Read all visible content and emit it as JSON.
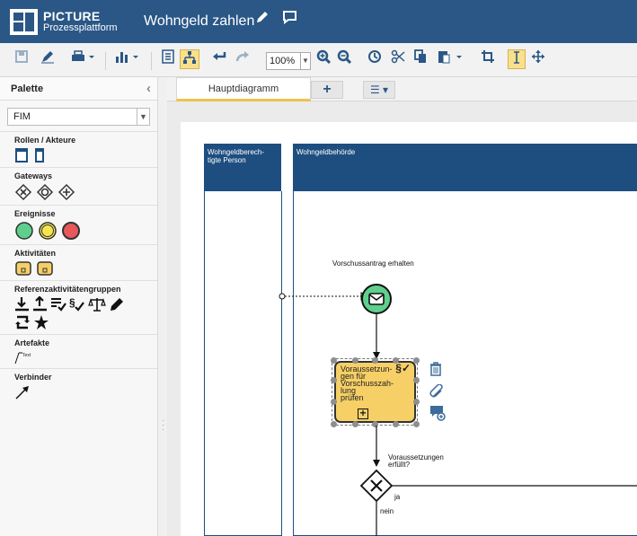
{
  "header": {
    "brand_line1": "PICTURE",
    "brand_line2": "Prozessplattform",
    "document_title": "Wohngeld zahlen",
    "edit_icon": "pencil-icon",
    "comment_icon": "speech-bubble-icon"
  },
  "toolbar": {
    "zoom_value": "100%",
    "icons": [
      "save-icon",
      "sign-icon",
      "print-icon",
      "chart-icon",
      "list-icon",
      "hierarchy-icon",
      "undo-icon",
      "redo-icon",
      "zoom-in-icon",
      "zoom-out-icon",
      "history-icon",
      "cut-icon",
      "copy-icon",
      "paste-icon",
      "crop-icon",
      "text-cursor-icon",
      "move-icon"
    ]
  },
  "palette": {
    "title": "Palette",
    "library": "FIM",
    "sections": [
      {
        "title": "Rollen / Akteure"
      },
      {
        "title": "Gateways"
      },
      {
        "title": "Ereignisse"
      },
      {
        "title": "Aktivitäten"
      },
      {
        "title": "Referenzaktivitätengruppen"
      },
      {
        "title": "Artefakte",
        "text_item": "Text"
      },
      {
        "title": "Verbinder"
      }
    ]
  },
  "tabs": {
    "active": "Hauptdiagramm"
  },
  "diagram": {
    "lanes": [
      {
        "name": "Wohngeldberech-\ntigte Person"
      },
      {
        "name": "Wohngeldbehörde"
      }
    ],
    "start_event_label": "Vorschussantrag erhalten",
    "task_label": "Voraussetzun-\ngen für\nVorschusszah-\nlung\nprüfen",
    "gateway_label": "Voraussetzungen\nerfüllt?",
    "flow_yes": "ja",
    "flow_no": "nein",
    "colors": {
      "lane_header": "#1e4e80",
      "task_fill": "#f6cf66",
      "start_event": "#5fcf8e",
      "header_bar": "#2a5786"
    }
  }
}
